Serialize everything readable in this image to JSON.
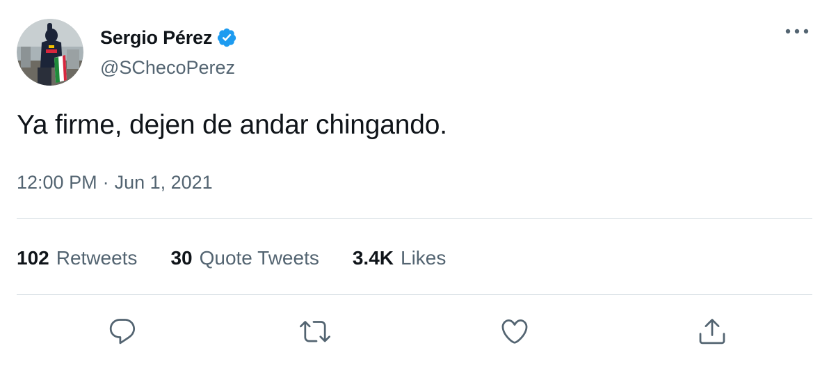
{
  "tweet": {
    "author": {
      "display_name": "Sergio Pérez",
      "handle": "@SChecoPerez",
      "verified": true
    },
    "text": "Ya firme, dejen de andar chingando.",
    "timestamp": {
      "time": "12:00 PM",
      "separator": "·",
      "date": "Jun 1, 2021"
    },
    "stats": [
      {
        "count": "102",
        "label": "Retweets"
      },
      {
        "count": "30",
        "label": "Quote Tweets"
      },
      {
        "count": "3.4K",
        "label": "Likes"
      }
    ],
    "actions": [
      {
        "icon": "reply-icon"
      },
      {
        "icon": "retweet-icon"
      },
      {
        "icon": "like-icon"
      },
      {
        "icon": "share-icon"
      }
    ],
    "menu_icon": "more-icon"
  },
  "colors": {
    "primary_text": "#0f1419",
    "secondary_text": "#536471",
    "verified": "#1d9bf0",
    "divider": "#cfd9de"
  }
}
